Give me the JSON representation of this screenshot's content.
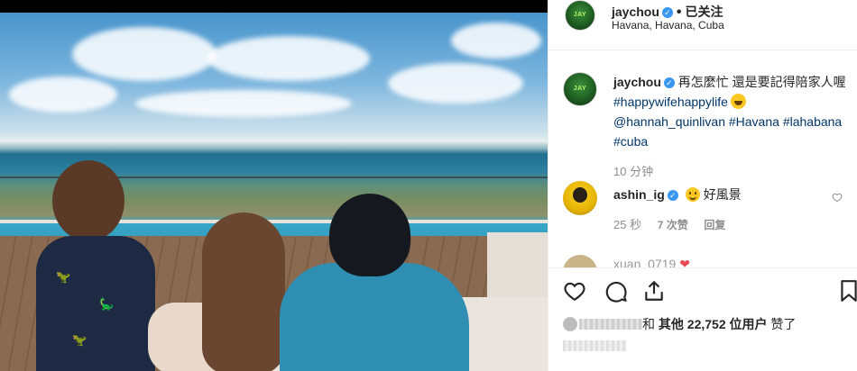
{
  "post": {
    "author": {
      "username": "jaychou",
      "avatar_text": "JAY",
      "verified": true
    },
    "follow_state": "已关注",
    "location": "Havana, Havana, Cuba",
    "caption": {
      "text_before": "再怎麼忙 還是要記得陪家人喔 ",
      "hashtag1": "#happywifehappylife",
      "mention": "@hannah_quinlivan",
      "hashtag2": "#Havana",
      "hashtag3": "#lahabana",
      "hashtag4": "#cuba"
    },
    "time_ago": "10 分钟"
  },
  "comments": [
    {
      "username": "ashin_ig",
      "verified": true,
      "text": "好風景",
      "time_ago": "25 秒",
      "likes_label": "7 次赞",
      "reply_label": "回复"
    }
  ],
  "peek_comment": {
    "username": "xuan_0719"
  },
  "likes": {
    "connector": "和",
    "others_label": "其他",
    "count": "22,752",
    "users_label": "位用户",
    "suffix": "赞了"
  },
  "icons": {
    "like": "heart-icon",
    "comment": "comment-icon",
    "share": "share-icon",
    "save": "bookmark-icon"
  },
  "colors": {
    "link": "#003569",
    "verified": "#3897f0",
    "muted": "#8e8e8e"
  }
}
